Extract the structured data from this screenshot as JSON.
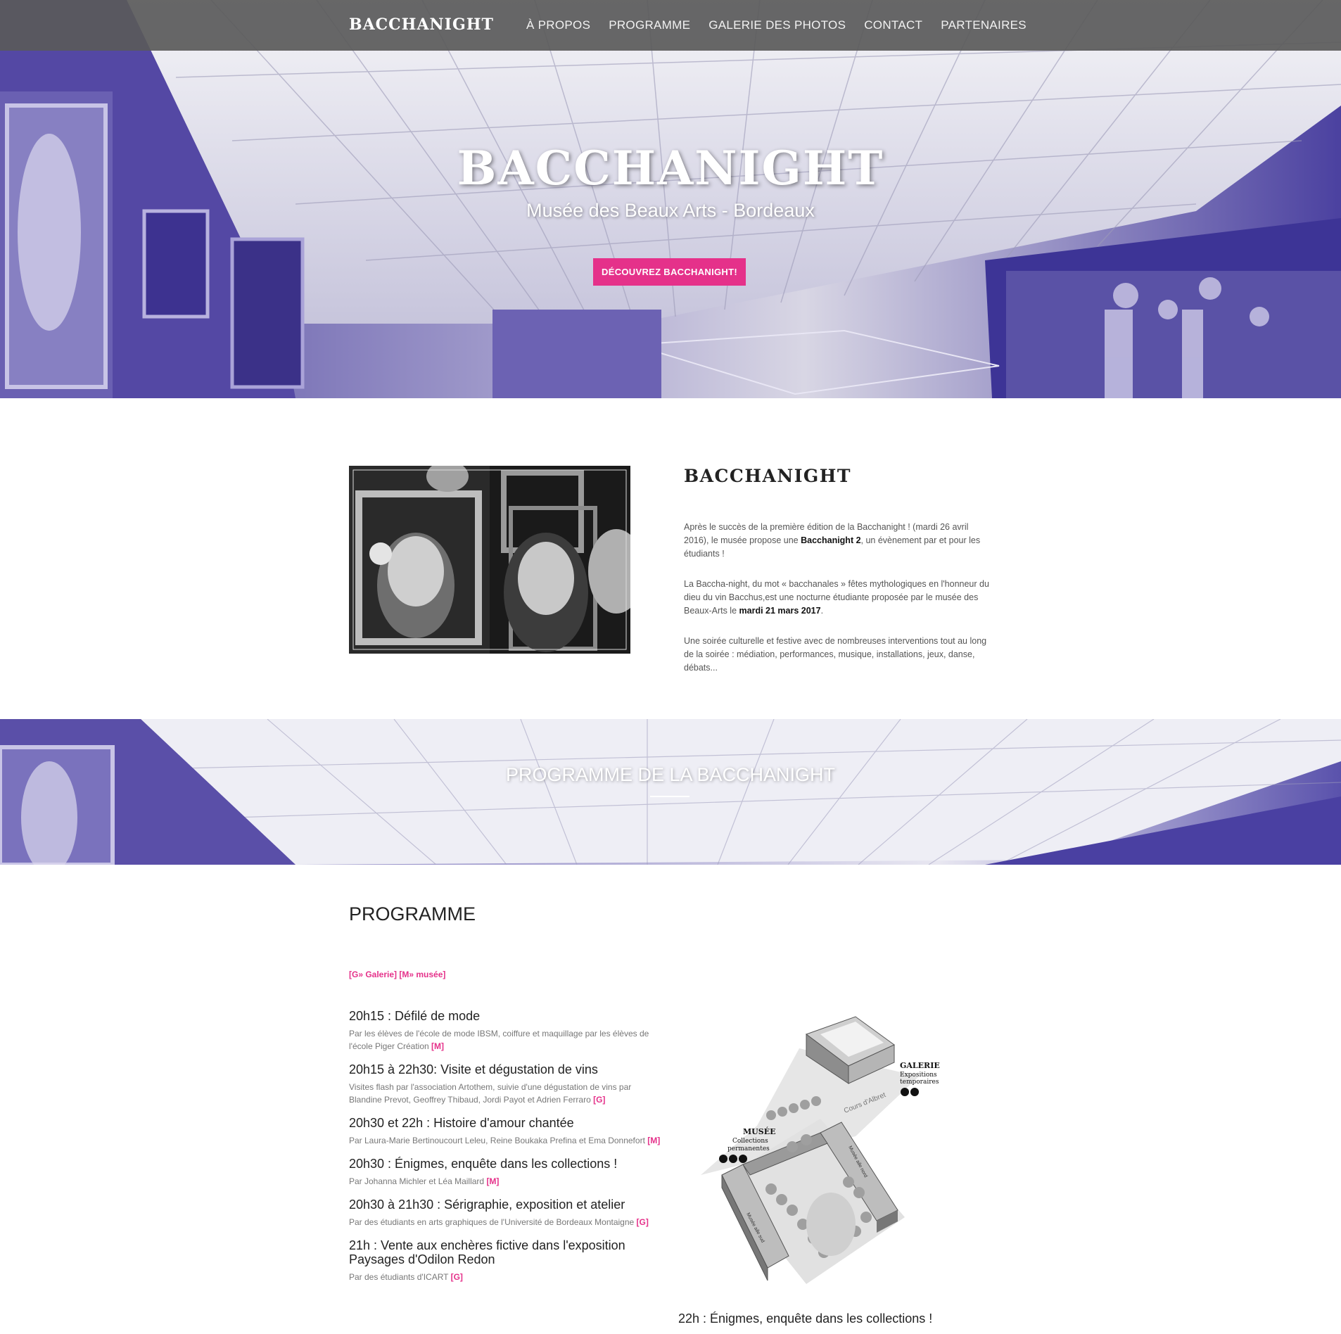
{
  "nav": {
    "brand": "BACCHANIGHT",
    "items": [
      {
        "label": "À PROPOS"
      },
      {
        "label": "PROGRAMME"
      },
      {
        "label": "GALERIE DES PHOTOS"
      },
      {
        "label": "CONTACT"
      },
      {
        "label": "PARTENAIRES"
      }
    ]
  },
  "hero": {
    "title": "BACCHANIGHT",
    "subtitle": "Musée des Beaux Arts - Bordeaux",
    "button": "DÉCOUVREZ BACCHANIGHT!"
  },
  "about": {
    "title": "BACCHANIGHT",
    "p1_a": "Après le succès de la première édition de la Bacchanight ! (mardi 26 avril 2016), le musée propose une ",
    "p1_b": "Bacchanight 2",
    "p1_c": ", un évènement par et pour les étudiants !",
    "p2_a": "La Baccha-night, du mot « bacchanales » fêtes mythologiques en l'honneur du dieu du vin Bacchus,est une nocturne étudiante proposée par le musée des Beaux-Arts le ",
    "p2_b": "mardi 21 mars 2017",
    "p2_c": ".",
    "p3": "Une soirée culturelle et festive avec de nombreuses interventions tout au long de la soirée : médiation, performances, musique, installations, jeux, danse, débats..."
  },
  "band": {
    "title": "PROGRAMME DE LA BACCHANIGHT"
  },
  "programme": {
    "heading": "PROGRAMME",
    "legend": "[G» Galerie] [M» musée]",
    "events": [
      {
        "title": "20h15 : Défilé de mode",
        "desc": "Par les élèves de l'école de mode IBSM, coiffure et maquillage par les élèves de l'école Piger Création ",
        "tag": "[M]"
      },
      {
        "title": "20h15 à 22h30: Visite et dégustation de vins",
        "desc": "Visites flash par l'association Artothem, suivie d'une dégustation de vins par Blandine Prevot, Geoffrey Thibaud, Jordi Payot et Adrien Ferraro ",
        "tag": "[G]"
      },
      {
        "title": "20h30 et 22h : Histoire d'amour chantée",
        "desc": "Par Laura-Marie Bertinoucourt Leleu, Reine Boukaka Prefina et Ema Donnefort ",
        "tag": "[M]"
      },
      {
        "title": "20h30 : Énigmes, enquête dans les collections !",
        "desc": "Par Johanna Michler et Léa Maillard ",
        "tag": "[M]"
      },
      {
        "title": "20h30 à 21h30 : Sérigraphie, exposition et atelier",
        "desc": "Par des étudiants en arts graphiques de l'Université de Bordeaux Montaigne ",
        "tag": "[G]"
      },
      {
        "title": "21h : Vente aux enchères fictive dans l'exposition Paysages d'Odilon Redon",
        "desc": "Par des étudiants d'ICART ",
        "tag": "[G]"
      }
    ],
    "side_event": "22h : Énigmes, enquête dans les collections !"
  },
  "map": {
    "galerie": "GALERIE",
    "galerie_sub1": "Expositions",
    "galerie_sub2": "temporaires",
    "musee": "MUSÉE",
    "musee_sub1": "Collections",
    "musee_sub2": "permanentes",
    "street1": "Cours d'Albret",
    "street2": "Musée aile nord",
    "street3": "Musée aile sud"
  },
  "colors": {
    "accent": "#e5318a",
    "hero_tint": "#5a4fa6",
    "nav_bg": "#5a5a5a"
  }
}
